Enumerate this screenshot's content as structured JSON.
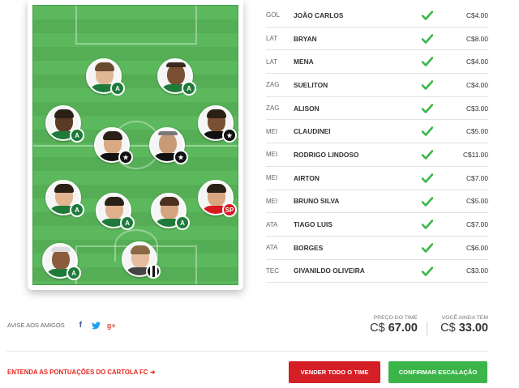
{
  "lineup": {
    "players": [
      {
        "pos": "GOL",
        "name": "JOÃO CARLOS",
        "price": "C$4.00"
      },
      {
        "pos": "LAT",
        "name": "BRYAN",
        "price": "C$8.00"
      },
      {
        "pos": "LAT",
        "name": "MENA",
        "price": "C$4.00"
      },
      {
        "pos": "ZAG",
        "name": "SUELITON",
        "price": "C$4.00"
      },
      {
        "pos": "ZAG",
        "name": "ALISON",
        "price": "C$3.00"
      },
      {
        "pos": "MEI",
        "name": "CLAUDINEI",
        "price": "C$5.00"
      },
      {
        "pos": "MEI",
        "name": "RODRIGO LINDOSO",
        "price": "C$11.00"
      },
      {
        "pos": "MEI",
        "name": "AIRTON",
        "price": "C$7.00"
      },
      {
        "pos": "MEI",
        "name": "BRUNO SILVA",
        "price": "C$5.00"
      },
      {
        "pos": "ATA",
        "name": "TIAGO LUIS",
        "price": "C$7.00"
      },
      {
        "pos": "ATA",
        "name": "BORGES",
        "price": "C$6.00"
      },
      {
        "pos": "TEC",
        "name": "GIVANILDO OLIVEIRA",
        "price": "C$3.00"
      }
    ],
    "check_color": "#3bb54a"
  },
  "share": {
    "label": "AVISE AOS AMIGOS",
    "icons": [
      "facebook-icon",
      "twitter-icon",
      "google-plus-icon"
    ],
    "facebook_glyph": "f",
    "google_glyph": "g+"
  },
  "totals": {
    "team_price_label": "PREÇO DO TIME",
    "team_price_currency": "C$",
    "team_price_value": "67.00",
    "remaining_label": "VOCÊ AINDA TEM",
    "remaining_currency": "C$",
    "remaining_value": "33.00"
  },
  "footer": {
    "rules_link": "ENTENDA AS PONTUAÇÕES DO CARTOLA FC ➜",
    "sell_button": "VENDER TODO O TIME",
    "confirm_button": "CONFIRMAR ESCALAÇÃO"
  },
  "colors": {
    "pitch": "#5cb85c",
    "sell": "#d41f26",
    "confirm": "#3bb54a",
    "link": "#e4281d"
  }
}
